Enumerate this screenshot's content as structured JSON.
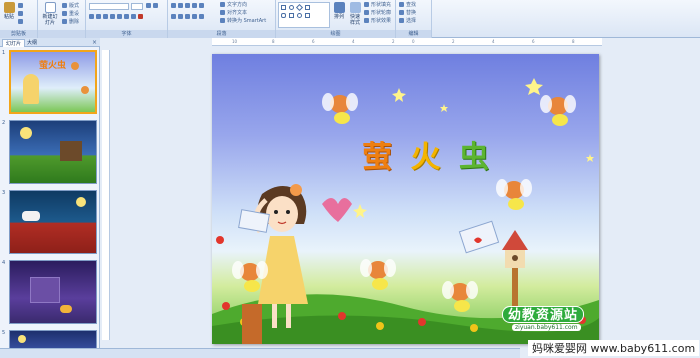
{
  "ribbon": {
    "groups": [
      "剪贴板",
      "",
      "字体",
      "",
      "段落",
      "",
      "绘图",
      "",
      "编辑"
    ],
    "font_name": "",
    "font_size": "",
    "buttons": {
      "paste": "粘贴",
      "new_slide": "新建幻灯片",
      "layout": "版式",
      "reset": "重设",
      "delete": "删除",
      "arrange": "排列",
      "quick_styles": "快速样式",
      "find": "查找",
      "replace": "替换",
      "select": "选择"
    },
    "paragraph_items": [
      "文字方向",
      "对齐文本",
      "转换为 SmartArt"
    ],
    "drawing_items": [
      "形状填充",
      "形状轮廓",
      "形状效果"
    ]
  },
  "pane": {
    "tabs": [
      "幻灯片",
      "大纲"
    ],
    "close": "×",
    "slides": [
      {
        "number": "1",
        "title": "萤火虫"
      },
      {
        "number": "2"
      },
      {
        "number": "3"
      },
      {
        "number": "4"
      },
      {
        "number": "5"
      }
    ]
  },
  "slide": {
    "title_chars": [
      "萤",
      "火",
      "虫"
    ],
    "logo_text": "幼教资源站",
    "logo_url": "ziyuan.baby611.com"
  },
  "watermark": "妈咪爱婴网 www.baby611.com",
  "colors": {
    "title_1": "#ee7f12",
    "title_2": "#f4b400",
    "title_3": "#5cb531",
    "selection": "#f2a51a"
  }
}
